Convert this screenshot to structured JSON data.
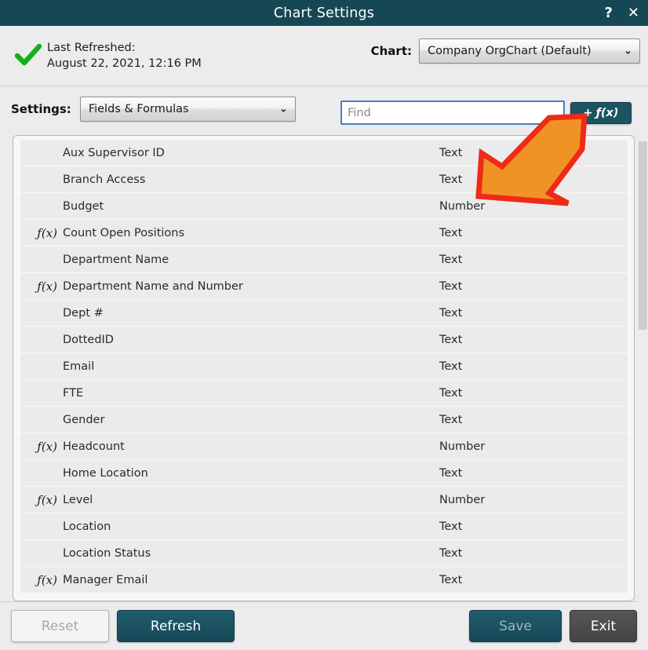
{
  "window": {
    "title": "Chart Settings",
    "help_label": "?",
    "close_label": "✕"
  },
  "header": {
    "status_icon": "green-check-icon",
    "last_refreshed_label": "Last Refreshed:",
    "last_refreshed_value": "August 22, 2021, 12:16 PM",
    "chart_label": "Chart:",
    "chart_selected": "Company OrgChart (Default)",
    "chevron": "⌄"
  },
  "settings": {
    "settings_label": "Settings:",
    "settings_selected": "Fields & Formulas",
    "find_value": "",
    "find_placeholder": "Find",
    "add_formula_label": "+",
    "add_formula_fx": "ƒ(x)"
  },
  "list": {
    "rows": [
      {
        "fx": "",
        "name": "Aux Supervisor ID",
        "type": "Text"
      },
      {
        "fx": "",
        "name": "Branch Access",
        "type": "Text"
      },
      {
        "fx": "",
        "name": "Budget",
        "type": "Number"
      },
      {
        "fx": "ƒ(x)",
        "name": "Count Open Positions",
        "type": "Text"
      },
      {
        "fx": "",
        "name": "Department Name",
        "type": "Text"
      },
      {
        "fx": "ƒ(x)",
        "name": "Department Name and Number",
        "type": "Text"
      },
      {
        "fx": "",
        "name": "Dept #",
        "type": "Text"
      },
      {
        "fx": "",
        "name": "DottedID",
        "type": "Text"
      },
      {
        "fx": "",
        "name": "Email",
        "type": "Text"
      },
      {
        "fx": "",
        "name": "FTE",
        "type": "Text"
      },
      {
        "fx": "",
        "name": "Gender",
        "type": "Text"
      },
      {
        "fx": "ƒ(x)",
        "name": "Headcount",
        "type": "Number"
      },
      {
        "fx": "",
        "name": "Home Location",
        "type": "Text"
      },
      {
        "fx": "ƒ(x)",
        "name": "Level",
        "type": "Number"
      },
      {
        "fx": "",
        "name": "Location",
        "type": "Text"
      },
      {
        "fx": "",
        "name": "Location Status",
        "type": "Text"
      },
      {
        "fx": "ƒ(x)",
        "name": "Manager Email",
        "type": "Text"
      }
    ]
  },
  "footer": {
    "reset_label": "Reset",
    "refresh_label": "Refresh",
    "save_label": "Save",
    "exit_label": "Exit"
  },
  "colors": {
    "titlebar": "#154854",
    "accent_teal": "#1c5464",
    "check_green": "#12b019",
    "annotation_fill": "#ef9324",
    "annotation_stroke": "#ef2a17",
    "find_border": "#4a7ebb"
  }
}
